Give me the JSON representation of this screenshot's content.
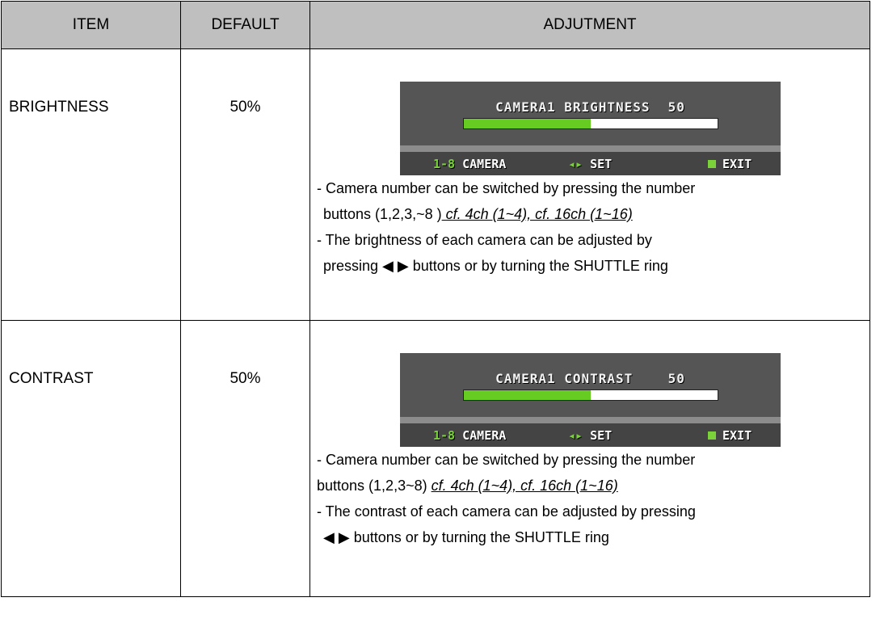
{
  "header": {
    "item": "ITEM",
    "default": "DEFAULT",
    "adjustment": "ADJUTMENT"
  },
  "rows": [
    {
      "item": "BRIGHTNESS",
      "default": "50%",
      "osd": {
        "title": "CAMERA1 BRIGHTNESS",
        "value": "50",
        "level": 0.5,
        "camera_key": "1-8",
        "camera_label": "CAMERA",
        "set_key": "◂▸",
        "set_label": "SET",
        "exit_label": "EXIT"
      },
      "desc": {
        "line1": "- Camera number can be switched by pressing the number",
        "line2_text": "buttons (1,2,3,~8 )",
        "line2_ref": " cf. 4ch (1~4), cf. 16ch (1~16)",
        "line3": "- The brightness of each camera can be adjusted by",
        "line4": "pressing ◀ ▶ buttons or by turning the SHUTTLE ring"
      }
    },
    {
      "item": "CONTRAST",
      "default": "50%",
      "osd": {
        "title": "CAMERA1 CONTRAST  ",
        "value": "50",
        "level": 0.5,
        "camera_key": "1-8",
        "camera_label": "CAMERA",
        "set_key": "◂▸",
        "set_label": "SET",
        "exit_label": "EXIT"
      },
      "desc": {
        "line1": "- Camera number can be switched by pressing the number",
        "line2_text": "buttons (1,2,3~8) ",
        "line2_ref": "cf. 4ch (1~4), cf. 16ch (1~16)",
        "line3": "- The contrast of each camera can be adjusted by pressing",
        "line4": "◀ ▶ buttons or by turning the SHUTTLE ring"
      }
    }
  ]
}
